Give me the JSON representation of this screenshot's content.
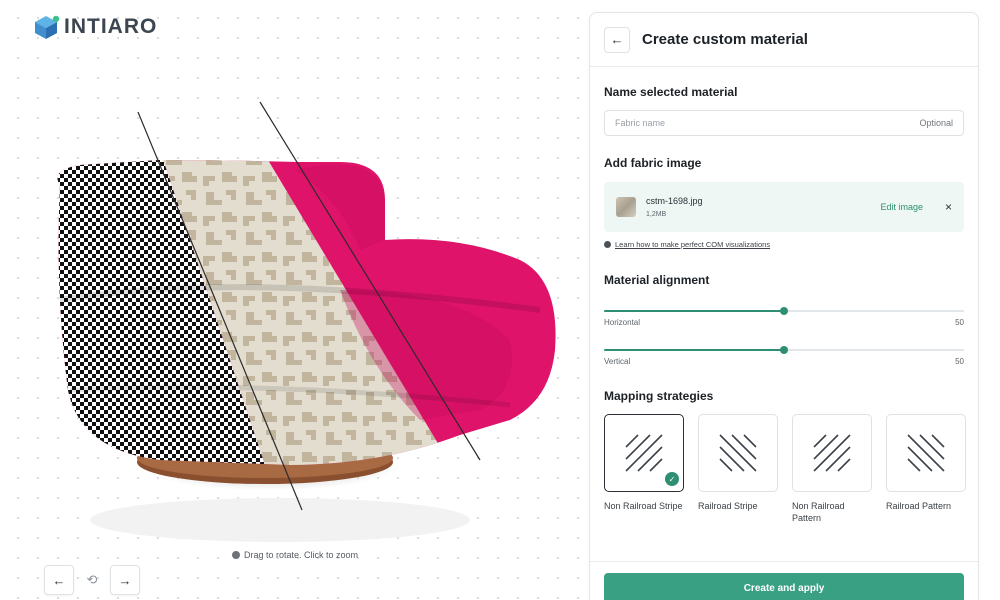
{
  "brand": {
    "name": "INTIARO",
    "logo_icon": "intiaro-cube-logo-icon"
  },
  "viewer": {
    "hint": "Drag to rotate. Click to zoom",
    "prev_icon": "←",
    "rotate_icon": "⟲",
    "next_icon": "→",
    "colors": {
      "pink": "#e0136b",
      "houndstooth": "#111111",
      "beige": "#d9d1c2"
    }
  },
  "panel": {
    "back_icon": "←",
    "title": "Create custom material",
    "name_section": {
      "title": "Name selected material",
      "placeholder": "Fabric name",
      "optional_label": "Optional"
    },
    "image_section": {
      "title": "Add fabric image",
      "file_name": "cstm-1698.jpg",
      "file_size": "1,2MB",
      "edit_label": "Edit image",
      "remove_icon": "×",
      "learn_link": "Learn how to make perfect COM visualizations"
    },
    "alignment": {
      "title": "Material alignment",
      "horizontal": {
        "label": "Horizontal",
        "value": "50",
        "level": 0.5
      },
      "vertical": {
        "label": "Vertical",
        "value": "50",
        "level": 0.5
      }
    },
    "mapping": {
      "title": "Mapping strategies",
      "options": [
        {
          "label": "Non Railroad Stripe",
          "selected": true,
          "icon": "diagonal-stripes-icon"
        },
        {
          "label": "Railroad Stripe",
          "selected": false,
          "icon": "diagonal-stripes-reverse-icon"
        },
        {
          "label": "Non Railroad Pattern",
          "selected": false,
          "icon": "diagonal-pattern-icon"
        },
        {
          "label": "Railroad Pattern",
          "selected": false,
          "icon": "diagonal-pattern-reverse-icon"
        }
      ]
    },
    "apply_label": "Create and apply",
    "accent": "#3aa083"
  }
}
